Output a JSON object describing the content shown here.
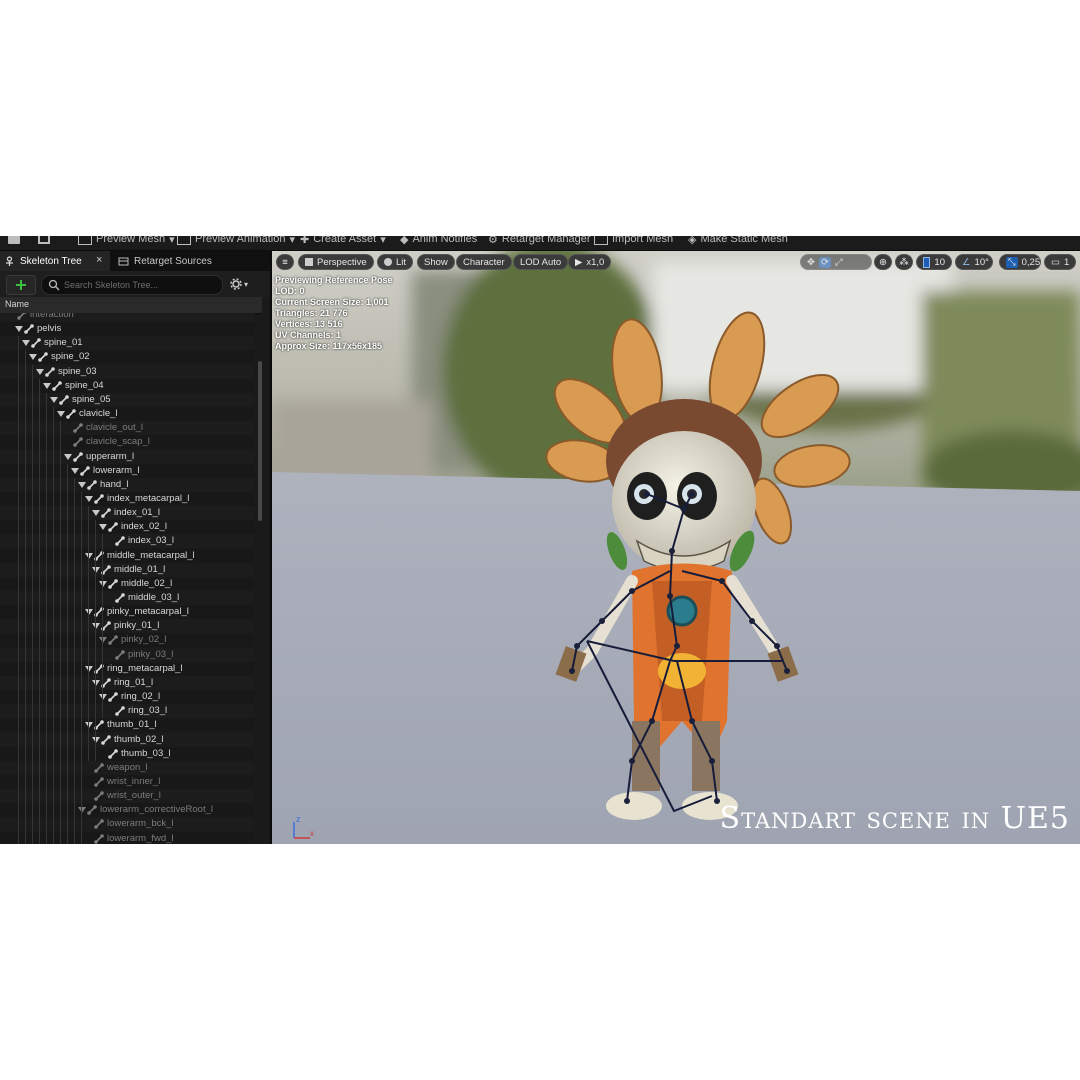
{
  "toolbar": {
    "items": [
      "Preview Mesh",
      "Preview Animation",
      "Create Asset",
      "Anim Notifies",
      "Retarget Manager",
      "Import Mesh",
      "Make Static Mesh"
    ]
  },
  "left_panel": {
    "tabs": [
      {
        "label": "Skeleton Tree",
        "active": true
      },
      {
        "label": "Retarget Sources",
        "active": false
      }
    ],
    "search_placeholder": "Search Skeleton Tree...",
    "column_header": "Name",
    "tree": [
      {
        "name": "interaction",
        "depth": 0,
        "expanded": false,
        "dim": true,
        "has_child": false,
        "partial": true
      },
      {
        "name": "pelvis",
        "depth": 1,
        "expanded": true,
        "dim": false,
        "has_child": true
      },
      {
        "name": "spine_01",
        "depth": 2,
        "expanded": true,
        "dim": false,
        "has_child": true
      },
      {
        "name": "spine_02",
        "depth": 3,
        "expanded": true,
        "dim": false,
        "has_child": true
      },
      {
        "name": "spine_03",
        "depth": 4,
        "expanded": true,
        "dim": false,
        "has_child": true
      },
      {
        "name": "spine_04",
        "depth": 5,
        "expanded": true,
        "dim": false,
        "has_child": true
      },
      {
        "name": "spine_05",
        "depth": 6,
        "expanded": true,
        "dim": false,
        "has_child": true
      },
      {
        "name": "clavicle_l",
        "depth": 7,
        "expanded": true,
        "dim": false,
        "has_child": true
      },
      {
        "name": "clavicle_out_l",
        "depth": 8,
        "expanded": false,
        "dim": true,
        "has_child": false
      },
      {
        "name": "clavicle_scap_l",
        "depth": 8,
        "expanded": false,
        "dim": true,
        "has_child": false
      },
      {
        "name": "upperarm_l",
        "depth": 8,
        "expanded": true,
        "dim": false,
        "has_child": true
      },
      {
        "name": "lowerarm_l",
        "depth": 9,
        "expanded": true,
        "dim": false,
        "has_child": true
      },
      {
        "name": "hand_l",
        "depth": 10,
        "expanded": true,
        "dim": false,
        "has_child": true
      },
      {
        "name": "index_metacarpal_l",
        "depth": 11,
        "expanded": true,
        "dim": false,
        "has_child": true
      },
      {
        "name": "index_01_l",
        "depth": 12,
        "expanded": true,
        "dim": false,
        "has_child": true
      },
      {
        "name": "index_02_l",
        "depth": 13,
        "expanded": true,
        "dim": false,
        "has_child": true
      },
      {
        "name": "index_03_l",
        "depth": 14,
        "expanded": false,
        "dim": false,
        "has_child": false
      },
      {
        "name": "middle_metacarpal_l",
        "depth": 11,
        "expanded": true,
        "dim": false,
        "has_child": true
      },
      {
        "name": "middle_01_l",
        "depth": 12,
        "expanded": true,
        "dim": false,
        "has_child": true
      },
      {
        "name": "middle_02_l",
        "depth": 13,
        "expanded": true,
        "dim": false,
        "has_child": true
      },
      {
        "name": "middle_03_l",
        "depth": 14,
        "expanded": false,
        "dim": false,
        "has_child": false
      },
      {
        "name": "pinky_metacarpal_l",
        "depth": 11,
        "expanded": true,
        "dim": false,
        "has_child": true
      },
      {
        "name": "pinky_01_l",
        "depth": 12,
        "expanded": true,
        "dim": false,
        "has_child": true
      },
      {
        "name": "pinky_02_l",
        "depth": 13,
        "expanded": true,
        "dim": true,
        "has_child": true
      },
      {
        "name": "pinky_03_l",
        "depth": 14,
        "expanded": false,
        "dim": true,
        "has_child": false
      },
      {
        "name": "ring_metacarpal_l",
        "depth": 11,
        "expanded": true,
        "dim": false,
        "has_child": true
      },
      {
        "name": "ring_01_l",
        "depth": 12,
        "expanded": true,
        "dim": false,
        "has_child": true
      },
      {
        "name": "ring_02_l",
        "depth": 13,
        "expanded": true,
        "dim": false,
        "has_child": true
      },
      {
        "name": "ring_03_l",
        "depth": 14,
        "expanded": false,
        "dim": false,
        "has_child": false
      },
      {
        "name": "thumb_01_l",
        "depth": 11,
        "expanded": true,
        "dim": false,
        "has_child": true
      },
      {
        "name": "thumb_02_l",
        "depth": 12,
        "expanded": true,
        "dim": false,
        "has_child": true
      },
      {
        "name": "thumb_03_l",
        "depth": 13,
        "expanded": false,
        "dim": false,
        "has_child": false
      },
      {
        "name": "weapon_l",
        "depth": 11,
        "expanded": false,
        "dim": true,
        "has_child": false
      },
      {
        "name": "wrist_inner_l",
        "depth": 11,
        "expanded": false,
        "dim": true,
        "has_child": false
      },
      {
        "name": "wrist_outer_l",
        "depth": 11,
        "expanded": false,
        "dim": true,
        "has_child": false
      },
      {
        "name": "lowerarm_correctiveRoot_l",
        "depth": 10,
        "expanded": true,
        "dim": true,
        "has_child": true
      },
      {
        "name": "lowerarm_bck_l",
        "depth": 11,
        "expanded": false,
        "dim": true,
        "has_child": false
      },
      {
        "name": "lowerarm_fwd_l",
        "depth": 11,
        "expanded": false,
        "dim": true,
        "has_child": false
      }
    ]
  },
  "viewport": {
    "toolbar": {
      "perspective": "Perspective",
      "lit": "Lit",
      "show": "Show",
      "character": "Character",
      "lod": "LOD Auto",
      "speed": "x1,0",
      "grid_snap": "10",
      "rotation_snap": "10°",
      "scale_snap": "0,25",
      "camera_speed": "1"
    },
    "stats": [
      "Previewing Reference Pose",
      "LOD: 0",
      "Current Screen Size: 1,001",
      "Triangles: 21 776",
      "Vertices: 13 516",
      "UV Channels: 1",
      "Approx Size: 117x56x185"
    ],
    "watermark": "Standart scene in UE5",
    "axis": {
      "z": "z",
      "x": "x"
    }
  },
  "colors": {
    "accent_blue": "#1e5fb3",
    "add_green": "#3fbf3f",
    "panel_bg": "#1a1a1a"
  }
}
